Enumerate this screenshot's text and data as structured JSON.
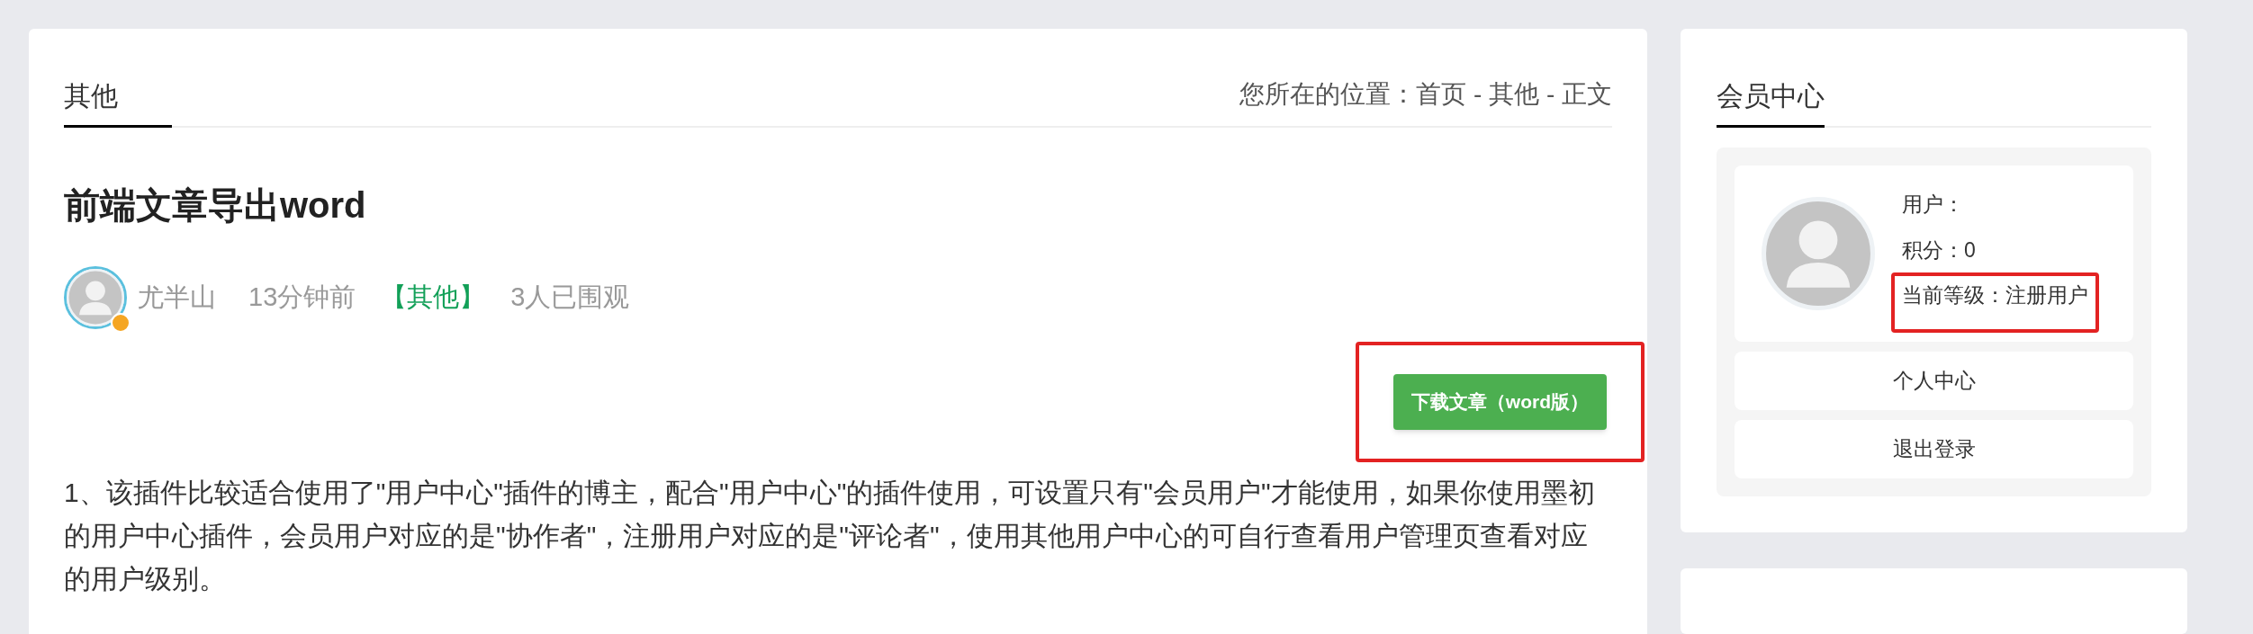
{
  "article": {
    "tab": "其他",
    "breadcrumb": [
      "您所在的位置：",
      "首页",
      " - ",
      "其他",
      " - ",
      "正文"
    ],
    "title": "前端文章导出word",
    "meta": {
      "author": "尤半山",
      "verified": true,
      "time": "13分钟前",
      "category": "【其他】",
      "views": "3人已围观"
    },
    "download_button": {
      "label": "下载文章（word版）",
      "highlighted": true
    },
    "paragraph": "1、该插件比较适合使用了\"用户中心\"插件的博主，配合\"用户中心\"的插件使用，可设置只有\"会员用户\"才能使用，如果你使用墨初的用户中心插件，会员用户对应的是\"协作者\"，注册用户对应的是\"评论者\"，使用其他用户中心的可自行查看用户管理页查看对应的用户级别。"
  },
  "sidebar": {
    "title": "会员中心",
    "profile": [
      {
        "text": "用户：",
        "highlighted": false
      },
      {
        "text": "积分：0",
        "highlighted": false
      },
      {
        "text": "当前等级：注册用户",
        "highlighted": true
      }
    ],
    "buttons": [
      "个人中心",
      "退出登录"
    ]
  }
}
